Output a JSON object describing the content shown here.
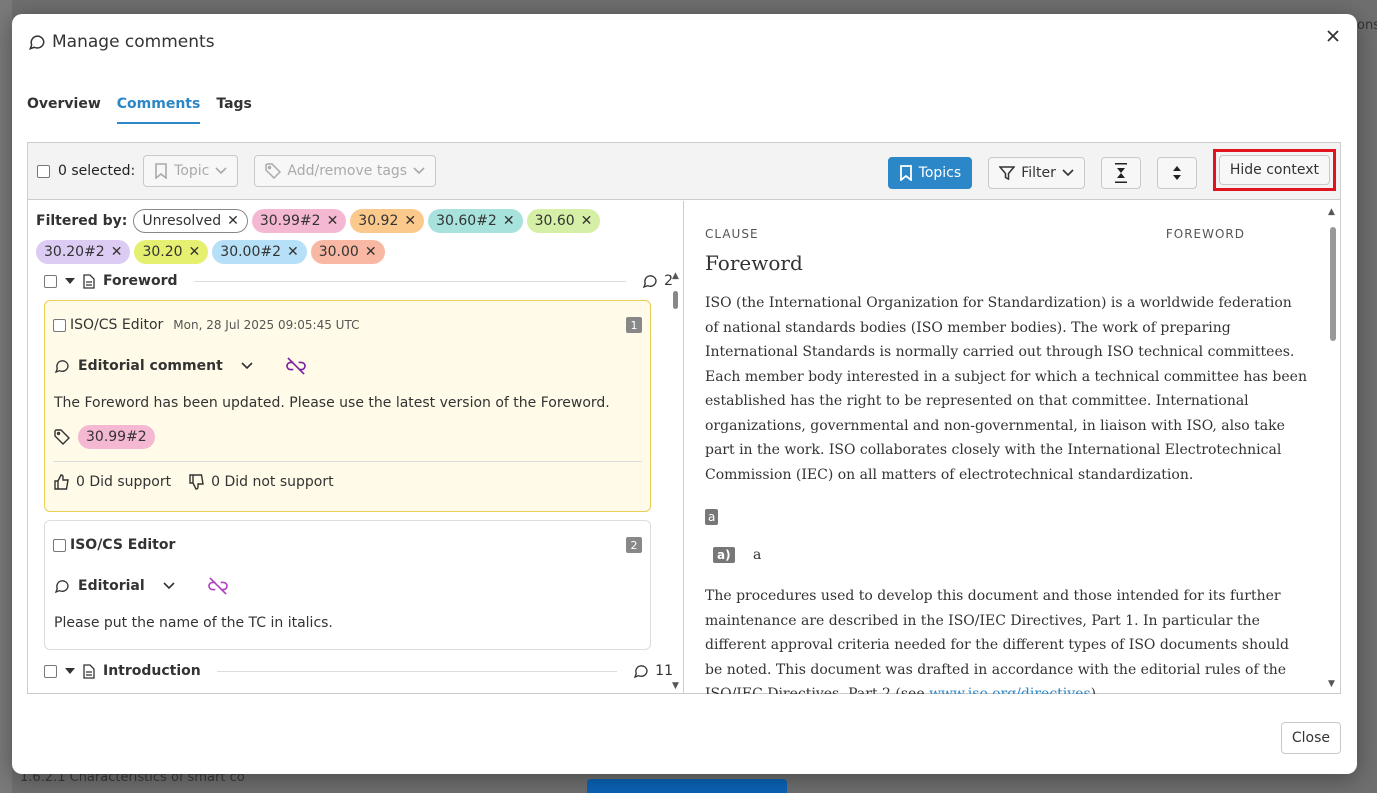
{
  "backdrop": {
    "bottom_text": "1.6.2.1 Characteristics of smart co",
    "right_text": "ons"
  },
  "modal": {
    "title": "Manage comments",
    "close_label": "Close"
  },
  "tabs": [
    {
      "label": "Overview",
      "active": false
    },
    {
      "label": "Comments",
      "active": true
    },
    {
      "label": "Tags",
      "active": false
    }
  ],
  "toolbar": {
    "selected_label": "0 selected:",
    "topic_label": "Topic",
    "tags_label": "Add/remove tags",
    "topics_label": "Topics",
    "filter_label": "Filter",
    "hide_context_label": "Hide context"
  },
  "filters": {
    "label": "Filtered by:",
    "chips": [
      {
        "label": "Unresolved",
        "color": "#ffffff",
        "border": "#888888"
      },
      {
        "label": "30.99#2",
        "color": "#f5b8d2"
      },
      {
        "label": "30.92",
        "color": "#fbc98c"
      },
      {
        "label": "30.60#2",
        "color": "#a7e3dc"
      },
      {
        "label": "30.60",
        "color": "#d5f0a6"
      },
      {
        "label": "30.20#2",
        "color": "#dccbf3"
      },
      {
        "label": "30.20",
        "color": "#e5ef70"
      },
      {
        "label": "30.00#2",
        "color": "#b6e0f7"
      },
      {
        "label": "30.00",
        "color": "#f9b8a3"
      }
    ]
  },
  "sections": [
    {
      "title": "Foreword",
      "count": "2",
      "comments": [
        {
          "author": "ISO/CS Editor",
          "date": "Mon, 28 Jul 2025 09:05:45 UTC",
          "number": "1",
          "type": "Editorial comment",
          "text": "The Foreword has been updated. Please use the latest version of the Foreword.",
          "tag": "30.99#2",
          "tag_color": "#f5b8d2",
          "support": "0 Did support",
          "not_support": "0 Did not support"
        },
        {
          "author": "ISO/CS Editor",
          "number": "2",
          "type": "Editorial",
          "text": "Please put the name of the TC in italics."
        }
      ]
    },
    {
      "title": "Introduction",
      "count": "11"
    }
  ],
  "document": {
    "clause_label": "CLAUSE",
    "section_label": "FOREWORD",
    "title": "Foreword",
    "para1": "ISO (the International Organization for Standardization) is a worldwide federation of national standards bodies (ISO member bodies). The work of preparing International Standards is normally carried out through ISO technical committees. Each member body interested in a subject for which a technical committee has been established has the right to be represented on that committee. International organizations, governmental and non-governmental, in liaison with ISO, also take part in the work. ISO collaborates closely with the International Electrotechnical Commission (IEC) on all matters of electrotechnical standardization.",
    "tag_a": "a",
    "tag_aa": "a)",
    "aa_text": "a",
    "para2_pre": "The procedures used to develop this document and those intended for its further maintenance are described in the ISO/IEC Directives, Part 1. In particular the different approval criteria needed for the different types of ISO documents should be noted. This document was drafted in accordance with the editorial rules of the ISO/IEC Directives, Part 2 (see ",
    "para2_link": "www.iso.org/directives",
    "para2_post": ")."
  },
  "colors": {
    "accent": "#2b87c8",
    "highlight_border": "#e0141e",
    "unlink_icon": "#7a1fa2"
  }
}
